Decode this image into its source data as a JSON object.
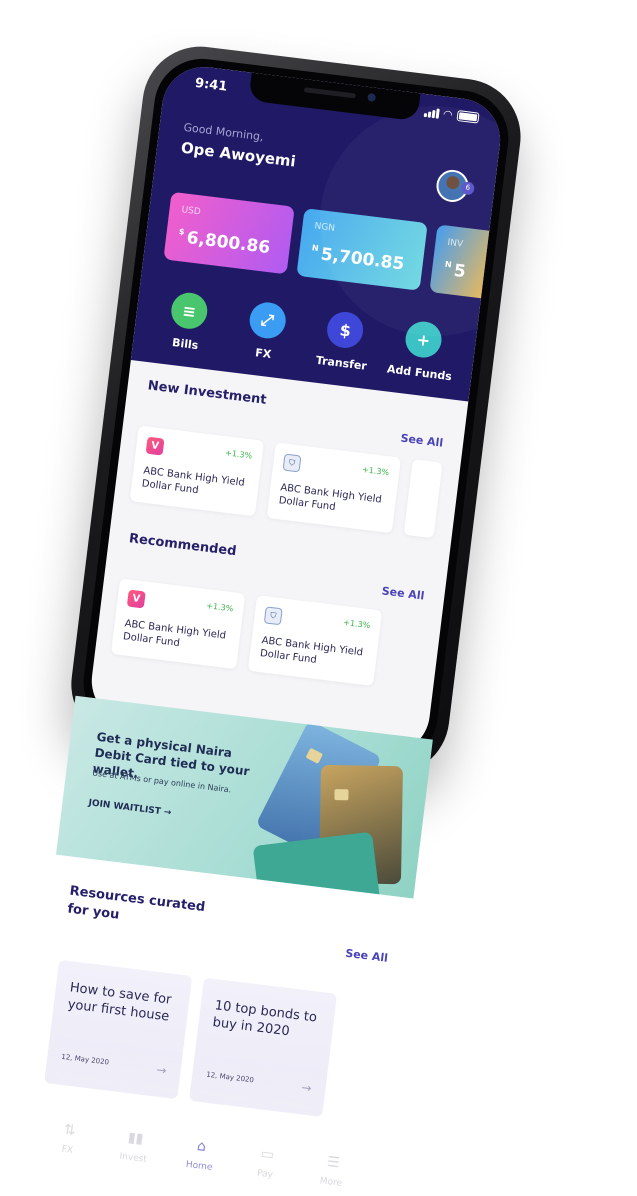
{
  "status": {
    "time": "9:41"
  },
  "header": {
    "greeting": "Good Morning,",
    "user_name": "Ope Awoyemi",
    "notification_count": "6"
  },
  "wallets": [
    {
      "currency": "USD",
      "symbol": "$",
      "amount": "6,800.86"
    },
    {
      "currency": "NGN",
      "symbol": "N",
      "amount": "5,700.85"
    },
    {
      "currency": "INV",
      "symbol": "N",
      "amount": "5"
    }
  ],
  "actions": [
    {
      "label": "Bills",
      "icon": "receipt-icon",
      "glyph": "≡"
    },
    {
      "label": "FX",
      "icon": "expand-arrows-icon",
      "glyph": "⤢"
    },
    {
      "label": "Transfer",
      "icon": "dollar-transfer-icon",
      "glyph": "$"
    },
    {
      "label": "Add Funds",
      "icon": "plus-icon",
      "glyph": "+"
    }
  ],
  "new_investment": {
    "title": "New Investment",
    "see_all": "See All",
    "items": [
      {
        "name": "ABC Bank High Yield Dollar Fund",
        "change": "+1.3%",
        "logo": "pink-v-logo-icon",
        "logo_glyph": "V"
      },
      {
        "name": "ABC Bank High Yield Dollar Fund",
        "change": "+1.3%",
        "logo": "bank-shield-logo-icon",
        "logo_glyph": ""
      }
    ]
  },
  "recommended": {
    "title": "Recommended",
    "see_all": "See All",
    "items": [
      {
        "name": "ABC Bank High Yield Dollar Fund",
        "change": "+1.3%",
        "logo": "pink-v-logo-icon",
        "logo_glyph": "V"
      },
      {
        "name": "ABC Bank High Yield Dollar Fund",
        "change": "+1.3%",
        "logo": "bank-shield-logo-icon",
        "logo_glyph": ""
      }
    ]
  },
  "banner": {
    "title": "Get a physical Naira Debit Card tied to your wallet.",
    "subtitle": "Use at ATMs or pay online in Naira.",
    "cta": "JOIN WAITLIST →"
  },
  "resources": {
    "title": "Resources curated for you",
    "see_all": "See All",
    "items": [
      {
        "title": "How to save for your first house",
        "date": "12, May 2020"
      },
      {
        "title": "10 top bonds to buy in 2020",
        "date": "12, May 2020"
      }
    ]
  },
  "tabs": [
    {
      "label": "FX",
      "icon": "swap-arrows-icon",
      "glyph": "⇅"
    },
    {
      "label": "Invest",
      "icon": "bar-chart-icon",
      "glyph": "▮▮"
    },
    {
      "label": "Home",
      "icon": "home-icon",
      "glyph": "⌂"
    },
    {
      "label": "Pay",
      "icon": "card-icon",
      "glyph": "▭"
    },
    {
      "label": "More",
      "icon": "menu-icon",
      "glyph": "☰"
    }
  ],
  "colors": {
    "primary": "#201a66",
    "accent": "#4a44b8",
    "positive": "#3ab54a"
  }
}
